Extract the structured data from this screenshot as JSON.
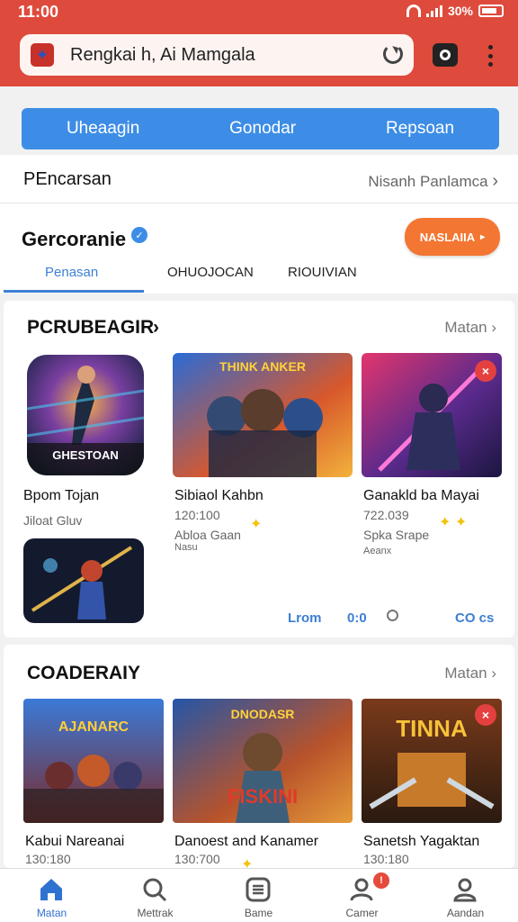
{
  "status_bar": {
    "time": "11:00",
    "battery": "30%"
  },
  "browser": {
    "url": "Rengkai h, Ai Mamgala"
  },
  "segmented": [
    "Uheaagin",
    "Gonodar",
    "Repsoan"
  ],
  "pencarsan": {
    "label": "PEncarsan",
    "link": "Nisanh Panlamca"
  },
  "profile": {
    "name": "Gercoranie",
    "button": "NASLAIIA",
    "tabs": [
      "Penasan",
      "OHUOJOCAN",
      "RIOUIVIAN"
    ]
  },
  "section1": {
    "title": "PCRUBEAGIR",
    "more": "Matan",
    "games": [
      {
        "name": "Bpom Tojan",
        "line1": "Jiloat Gluv",
        "line2": "",
        "line3": "",
        "art_text": "GHESTOAN"
      },
      {
        "name": "Sibiaol Kahbn",
        "line1": "120:100",
        "line2": "Abloa Gaan",
        "line3": "Nasu",
        "art_text": "THINK ANKER"
      },
      {
        "name": "Ganakld ba Mayai",
        "line1": "722.039",
        "line2": "Spka Srape",
        "line3": "Aeanx",
        "art_text": ""
      }
    ],
    "pager": {
      "left": "Lrom",
      "dots": "0:0",
      "right": "CO cs"
    }
  },
  "section2": {
    "title": "COADERAIY",
    "more": "Matan",
    "games": [
      {
        "name": "Kabui Nareanai",
        "line1": "130:180",
        "art_text": "AJANARC"
      },
      {
        "name": "Danoest and Kanamer",
        "line1": "130:700",
        "art_text": "FISKINI"
      },
      {
        "name": "Sanetsh Yagaktan",
        "line1": "130:180",
        "art_text": "TINNA"
      }
    ]
  },
  "bottom_nav": [
    {
      "label": "Matan",
      "icon": "home-icon"
    },
    {
      "label": "Mettrak",
      "icon": "search-icon"
    },
    {
      "label": "Bame",
      "icon": "list-icon"
    },
    {
      "label": "Camer",
      "icon": "user-icon",
      "badge": "!"
    },
    {
      "label": "Aandan",
      "icon": "profile-icon"
    }
  ],
  "colors": {
    "accent_red": "#de4a3c",
    "accent_blue": "#3d8de6",
    "accent_orange": "#f37632"
  }
}
